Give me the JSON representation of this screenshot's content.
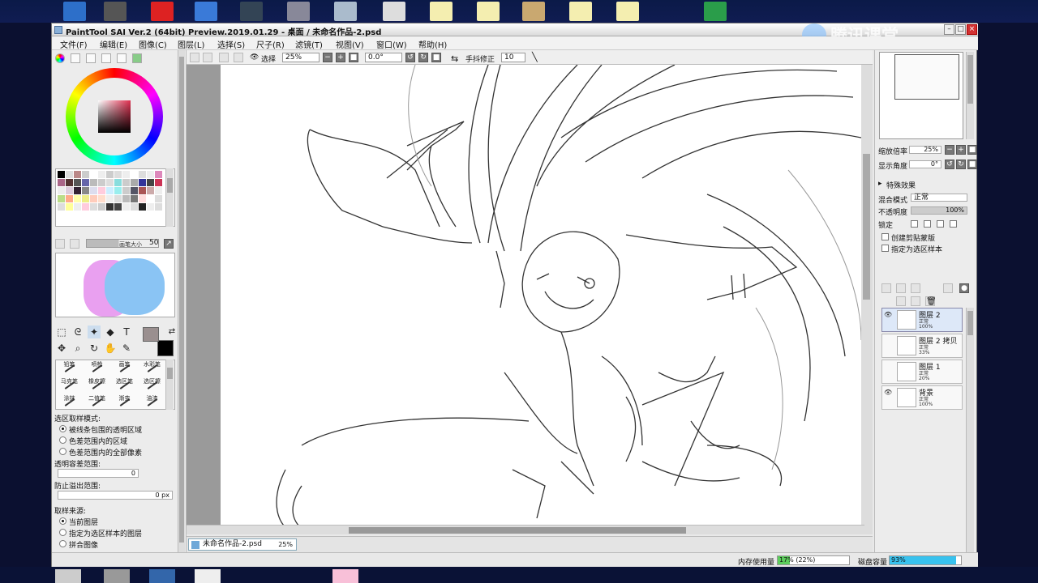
{
  "window": {
    "title": "PaintTool SAI Ver.2 (64bit) Preview.2019.01.29 - 桌面 / 未命名作品-2.psd",
    "watermark": "腾讯课堂"
  },
  "menu": [
    "文件(F)",
    "编辑(E)",
    "图像(C)",
    "图层(L)",
    "选择(S)",
    "尺子(R)",
    "滤镜(T)",
    "视图(V)",
    "窗口(W)",
    "帮助(H)"
  ],
  "toolbar": {
    "select_label": "选择",
    "zoom": "25%",
    "angle": "0.0°",
    "stabilizer_label": "手抖修正",
    "stabilizer_value": "10"
  },
  "brush_size": {
    "label": "画笔大小",
    "value": "50"
  },
  "brushes": [
    "铅笔",
    "喷枪",
    "画笔",
    "水彩笔",
    "马克笔",
    "橡皮擦",
    "选区笔",
    "选区擦",
    "涂抹",
    "二值笔",
    "渐变",
    "油漆"
  ],
  "left_options": {
    "sample_mode_label": "选区取样模式:",
    "sample_options": [
      "被线条包围的透明区域",
      "色差范围内的区域",
      "色差范围内的全部像素"
    ],
    "tolerance_label": "透明容差范围:",
    "tolerance_value": "0",
    "overflow_label": "防止溢出范围:",
    "overflow_value": "0 px",
    "source_label": "取样来源:",
    "source_options": [
      "当前图层",
      "指定为选区样本的图层",
      "拼合图像"
    ]
  },
  "navigator": {
    "zoom_label": "缩放倍率",
    "zoom_value": "25%",
    "angle_label": "显示角度",
    "angle_value": "0°"
  },
  "layer_props": {
    "effects_label": "特殊效果",
    "blend_label": "混合模式",
    "blend_value": "正常",
    "opacity_label": "不透明度",
    "opacity_value": "100%",
    "lock_label": "锁定",
    "clip_label": "创建剪贴蒙版",
    "sample_label": "指定为选区样本"
  },
  "layers": [
    {
      "name": "图层 2",
      "mode": "正常",
      "opacity": "100%",
      "visible": true,
      "selected": true
    },
    {
      "name": "图层 2 拷贝",
      "mode": "正常",
      "opacity": "33%",
      "visible": false,
      "selected": false
    },
    {
      "name": "图层 1",
      "mode": "正常",
      "opacity": "20%",
      "visible": false,
      "selected": false
    },
    {
      "name": "背景",
      "mode": "正常",
      "opacity": "100%",
      "visible": true,
      "selected": false
    }
  ],
  "document_tab": {
    "name": "未命名作品-2.psd",
    "zoom": "25%"
  },
  "status": {
    "memory_label": "内存使用量",
    "memory_value": "17% (22%)",
    "memory_fraction": 0.17,
    "disk_label": "磁盘容量",
    "disk_value": "93%",
    "disk_fraction": 0.93
  },
  "colors": {
    "primary": "#9a8f8f",
    "secondary": "#000000",
    "hue_selected": "#e03050"
  }
}
